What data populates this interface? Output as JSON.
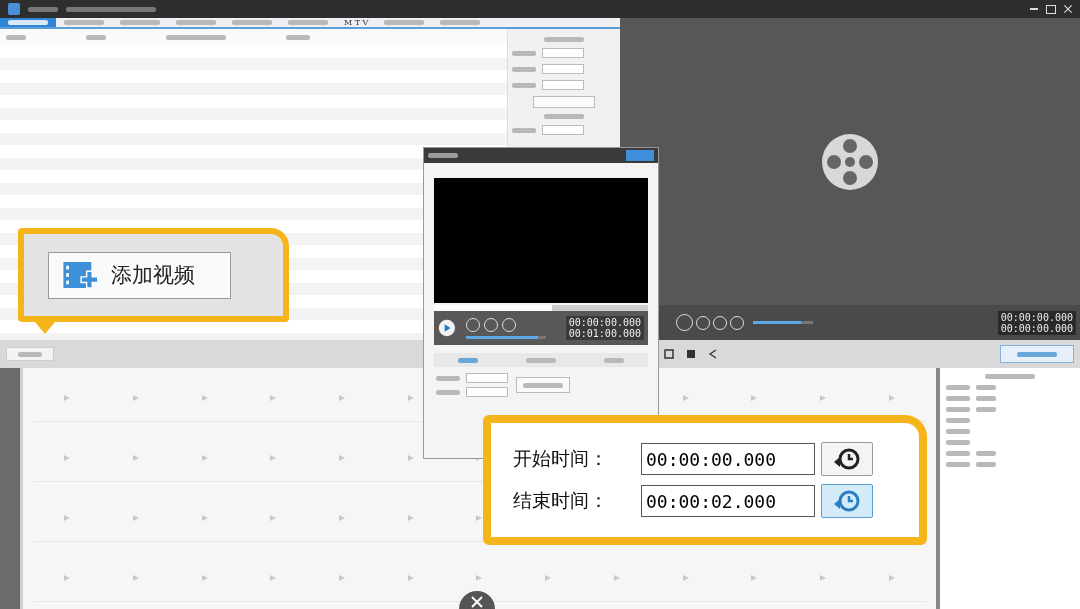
{
  "menu_tabs": [
    {
      "selected": true
    },
    {
      "selected": false
    },
    {
      "selected": false
    },
    {
      "selected": false
    },
    {
      "selected": false
    },
    {
      "selected": false
    },
    {
      "label": "M T V",
      "selected": false
    },
    {
      "selected": false
    },
    {
      "selected": false
    }
  ],
  "preview_player": {
    "timecodes": [
      "00:00:00.000",
      "00:00:00.000"
    ],
    "volume": {
      "level": 0.8
    }
  },
  "preview_dialog": {
    "timecodes": [
      "00:00:00.000",
      "00:01:00.000"
    ],
    "volume": {
      "level": 0.9
    },
    "seek": {
      "level": 0.55
    }
  },
  "add_video_callout": {
    "label": "添加视频"
  },
  "time_callout": {
    "rows": [
      {
        "label": "开始时间：",
        "value": "00:00:00.000",
        "highlighted": false
      },
      {
        "label": "结束时间：",
        "value": "00:00:02.000",
        "highlighted": true
      }
    ]
  }
}
